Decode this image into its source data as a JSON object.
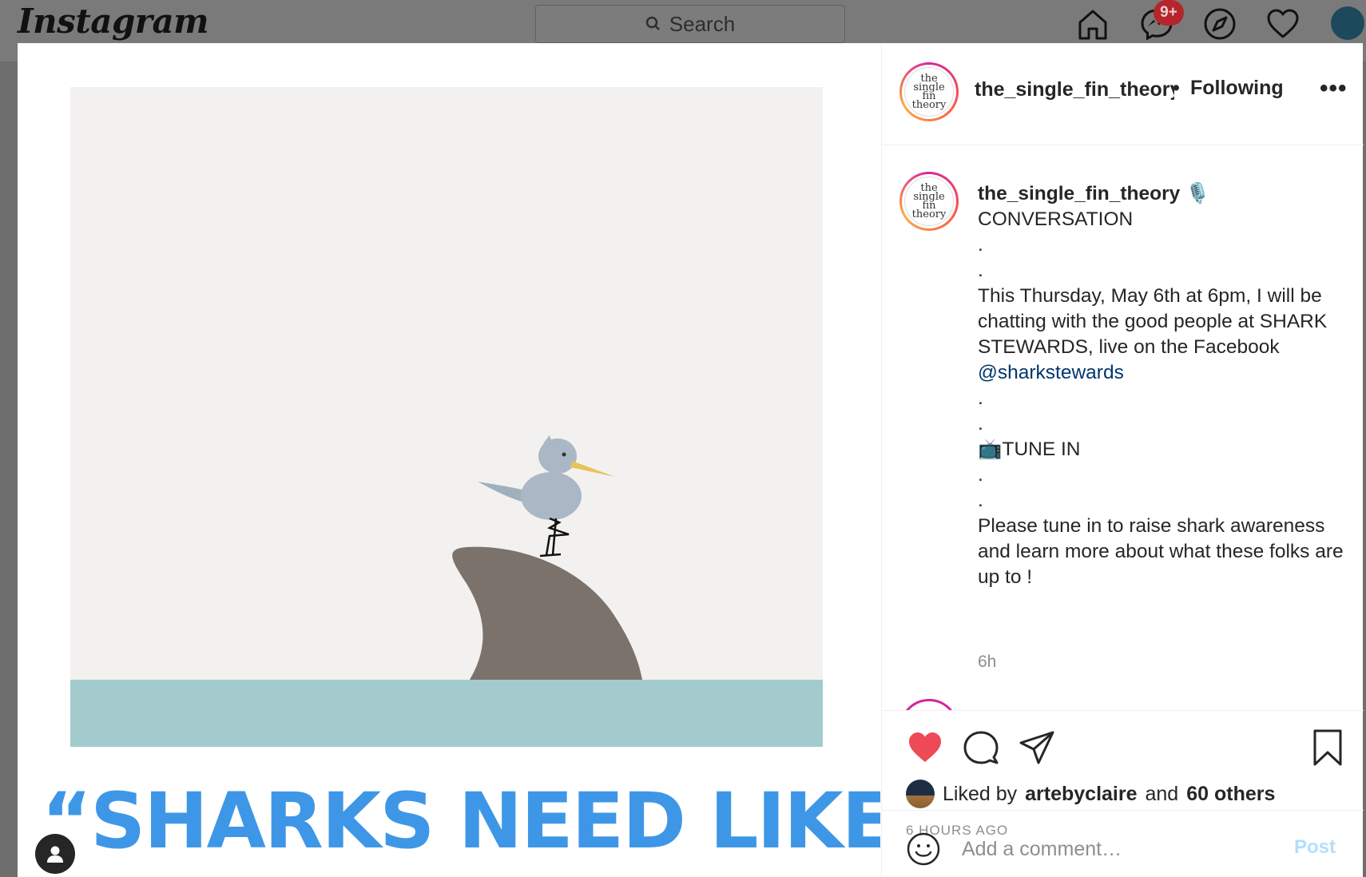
{
  "nav": {
    "logo": "Instagram",
    "search_placeholder": "Search",
    "messages_badge": "9+",
    "icons": [
      "home-icon",
      "messenger-icon",
      "explore-icon",
      "heart-icon",
      "profile-avatar"
    ]
  },
  "post": {
    "image_text": "“SHARKS NEED LIKES”",
    "header": {
      "username": "the_single_fin_theory",
      "separator": "•",
      "follow_status": "Following",
      "more_label": "•••"
    },
    "avatar_text": "the single fin theory",
    "caption": {
      "username": "the_single_fin_theory",
      "mic_emoji": "🎙️",
      "lines": [
        "CONVERSATION",
        ".",
        ".",
        "This Thursday, May 6th at 6pm, I will be chatting with the good people at SHARK STEWARDS, live on the Facebook",
        ".",
        ".",
        "📺TUNE IN",
        ".",
        ".",
        "Please tune in to raise shark awareness and learn more about what these folks are up to !"
      ],
      "mention": "@sharkstewards",
      "time": "6h"
    },
    "likes": {
      "prefix": "Liked by",
      "user": "artebyclaire",
      "and": "and",
      "others": "60 others"
    },
    "timestamp": "6 HOURS AGO",
    "comment": {
      "placeholder": "Add a comment…",
      "post_label": "Post"
    }
  },
  "colors": {
    "like_red": "#ed4956",
    "link_blue": "#00376b",
    "post_disabled": "#b2dffc",
    "poster_blue": "#3e97e6",
    "sea": "#a3cbcd",
    "fin": "#7b726c"
  }
}
